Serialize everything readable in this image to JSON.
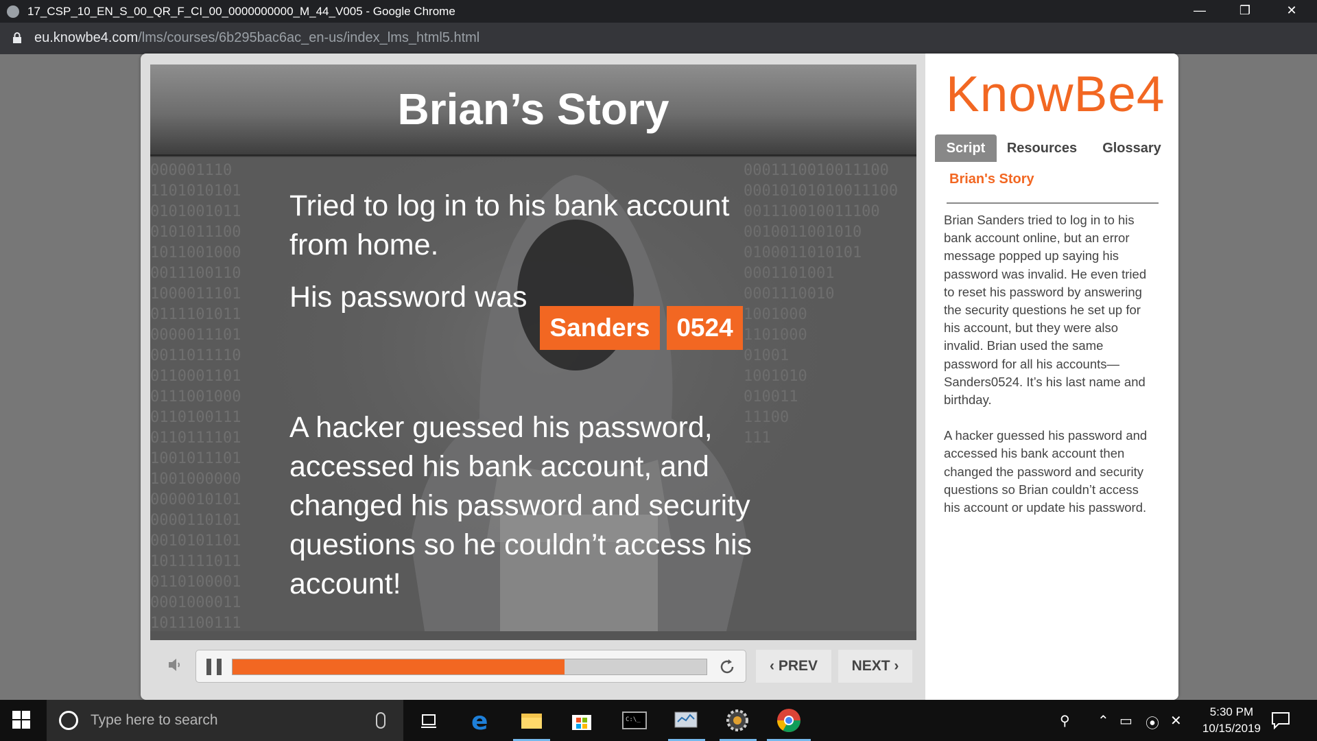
{
  "browser": {
    "title": "17_CSP_10_EN_S_00_QR_F_CI_00_0000000000_M_44_V005 - Google Chrome",
    "url_host": "eu.knowbe4.com",
    "url_path": "/lms/courses/6b295bac6ac_en-us/index_lms_html5.html",
    "minimize": "—",
    "restore": "❐",
    "close": "✕"
  },
  "slide": {
    "title": "Brian’s Story",
    "line1": "Tried to log in to his bank account from home.",
    "line2": "His password was",
    "tag1": "Sanders",
    "tag2": "0524",
    "line3": "A hacker guessed his password, accessed his bank account, and changed his password and security questions so he couldn’t access his account!"
  },
  "player": {
    "progress_percent": 70,
    "prev_label": "PREV",
    "next_label": "NEXT",
    "icons": [
      "speaker-icon",
      "pause-icon",
      "replay-icon",
      "chevron-left-icon",
      "chevron-right-icon"
    ]
  },
  "sidebar": {
    "logo": "KnowBe4",
    "tabs": [
      {
        "label": "Script",
        "active": true
      },
      {
        "label": "Resources",
        "active": false
      },
      {
        "label": "Glossary",
        "active": false
      }
    ],
    "script_title": "Brian's Story",
    "paragraph1": "Brian Sanders tried to log in to his bank account online, but an error message popped up saying his password was invalid. He even tried to reset his password by answering the security questions he set up for his account, but they were also invalid. Brian used the same password for all his accounts—Sanders0524. It’s his last name and birthday.",
    "paragraph2": "A hacker guessed his password and accessed his bank account then changed the password and security questions so Brian couldn’t access his account or update his password."
  },
  "taskbar": {
    "search_placeholder": "Type here to search",
    "time": "5:30 PM",
    "date": "10/15/2019"
  },
  "colors": {
    "accent": "#f26722",
    "chrome_dark": "#202124",
    "taskbar": "#101010"
  }
}
